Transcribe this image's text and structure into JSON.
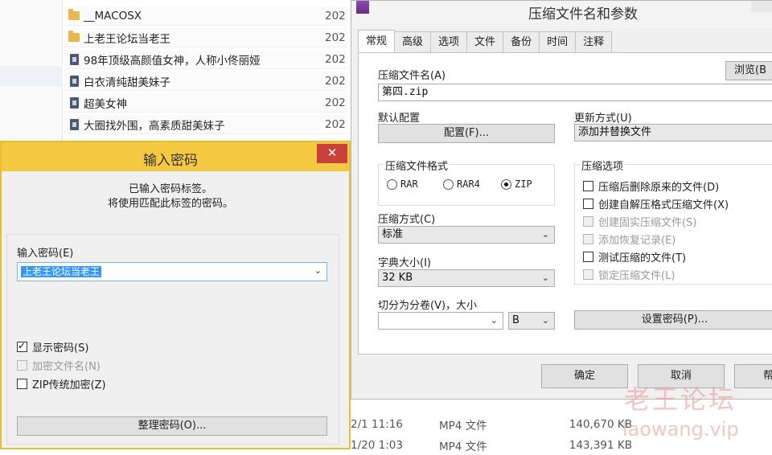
{
  "explorer": {
    "files": [
      {
        "name": "__MACOSX",
        "date": "202",
        "type": "folder"
      },
      {
        "name": "上老王论坛当老王",
        "date": "202",
        "type": "folder"
      },
      {
        "name": "98年顶级高颜值女神，人称小佟丽娅",
        "date": "202",
        "type": "video"
      },
      {
        "name": "白衣清纯甜美妹子",
        "date": "202",
        "type": "video"
      },
      {
        "name": "超美女神",
        "date": "202",
        "type": "video"
      },
      {
        "name": "大圈找外围，高素质甜美妹子",
        "date": "202",
        "type": "video"
      }
    ],
    "bottom_rows": [
      {
        "date": "2/1 11:16",
        "type": "MP4 文件",
        "size": "140,670 KB"
      },
      {
        "date": "1/20 1:03",
        "type": "MP4 文件",
        "size": "143,391 KB"
      }
    ]
  },
  "archive": {
    "title": "压缩文件名和参数",
    "tabs": [
      "常规",
      "高级",
      "选项",
      "文件",
      "备份",
      "时间",
      "注释"
    ],
    "archive_name_label": "压缩文件名(A)",
    "archive_name_value": "第四.zip",
    "browse_label": "浏览(B",
    "default_profile_label": "默认配置",
    "profile_button_label": "配置(F)...",
    "update_mode_label": "更新方式(U)",
    "update_mode_value": "添加并替换文件",
    "format_label": "压缩文件格式",
    "formats": [
      "RAR",
      "RAR4",
      "ZIP"
    ],
    "selected_format": "ZIP",
    "method_label": "压缩方式(C)",
    "method_value": "标准",
    "dict_label": "字典大小(I)",
    "dict_value": "32 KB",
    "split_label": "切分为分卷(V)，大小",
    "split_value": "",
    "split_unit": "B",
    "set_password_label": "设置密码(P)...",
    "options_label": "压缩选项",
    "options": [
      {
        "label": "压缩后删除原来的文件(D)",
        "disabled": false
      },
      {
        "label": "创建自解压格式压缩文件(X)",
        "disabled": false
      },
      {
        "label": "创建固实压缩文件(S)",
        "disabled": true
      },
      {
        "label": "添加恢复记录(E)",
        "disabled": true
      },
      {
        "label": "测试压缩的文件(T)",
        "disabled": false
      },
      {
        "label": "锁定压缩文件(L)",
        "disabled": true
      }
    ],
    "ok_label": "确定",
    "cancel_label": "取消",
    "help_label": "帮"
  },
  "password_dialog": {
    "title": "输入密码",
    "close_glyph": "✕",
    "info_line1": "已输入密码标签。",
    "info_line2": "将使用匹配此标签的密码。",
    "password_label": "输入密码(E)",
    "password_value": "上老王论坛当老王",
    "show_password_label": "显示密码(S)",
    "encrypt_names_label": "加密文件名(N)",
    "zip_legacy_label": "ZIP传统加密(Z)",
    "organize_label": "整理密码(O)..."
  },
  "watermark": {
    "line1": "老王论坛",
    "line2": "laowang.vip"
  }
}
